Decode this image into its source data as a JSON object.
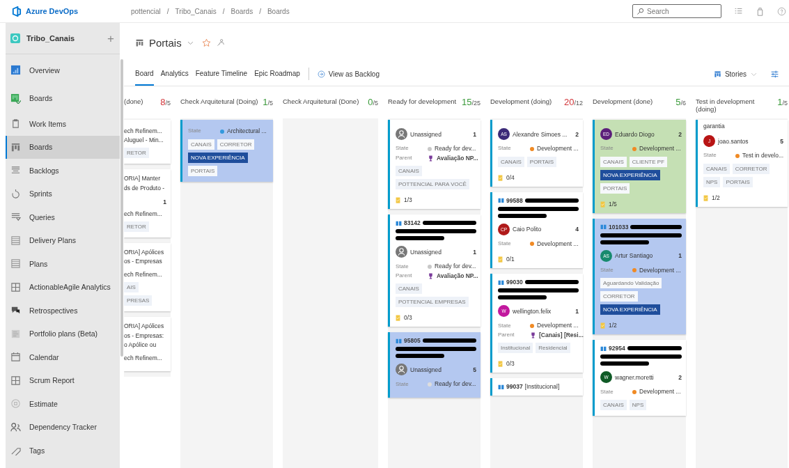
{
  "top_bar": {
    "logo": "Azure DevOps",
    "breadcrumb": [
      {
        "label": "pottencial",
        "separator": "/"
      },
      {
        "label": "Tribo_Canais",
        "separator": "/"
      },
      {
        "label": "Boards",
        "separator": "/"
      },
      {
        "label": "Boards"
      }
    ],
    "search": {
      "placeholder": "Search"
    }
  },
  "sidebar": {
    "project": "Tribo_Canais",
    "add": "+",
    "items": [
      {
        "label": "Overview",
        "selected": false
      },
      {
        "label": "Boards",
        "selected": false,
        "children": [
          {
            "label": "Work Items",
            "selected": false
          },
          {
            "label": "Boards",
            "selected": true
          },
          {
            "label": "Backlogs",
            "selected": false
          },
          {
            "label": "Sprints",
            "selected": false
          },
          {
            "label": "Queries",
            "selected": false
          },
          {
            "label": "Delivery Plans",
            "selected": false
          },
          {
            "label": "Plans",
            "selected": false
          },
          {
            "label": "ActionableAgile Analytics",
            "selected": false
          },
          {
            "label": "Retrospectives",
            "selected": false
          },
          {
            "label": "Portfolio plans (Beta)",
            "selected": false
          },
          {
            "label": "Calendar",
            "selected": false
          },
          {
            "label": "Scrum Report",
            "selected": false
          },
          {
            "label": "Estimate",
            "selected": false
          },
          {
            "label": "Dependency Tracker",
            "selected": false
          },
          {
            "label": "Tags",
            "selected": false
          }
        ]
      }
    ]
  },
  "board_header": {
    "title": "Portais",
    "tabs": [
      {
        "label": "Board",
        "selected": true
      },
      {
        "label": "Analytics",
        "selected": false
      },
      {
        "label": "Feature Timeline",
        "selected": false
      },
      {
        "label": "Epic Roadmap",
        "selected": false
      }
    ],
    "view_backlog": "View as Backlog",
    "level_picker": "Stories"
  },
  "columns": [
    {
      "title": "(done)",
      "count": "8",
      "limit": "/5",
      "over": true,
      "clipped": true,
      "cards": [
        {
          "color": "#ffffff",
          "fields": [
            {
              "kind": "area",
              "value": "ech Refinem..."
            },
            {
              "kind": "area",
              "value": "Aluguel - Min..."
            }
          ],
          "tags": [
            [
              {
                "text": "RETOR",
                "highlight": false
              }
            ]
          ]
        },
        {
          "color": "#ffffff",
          "lines": [
            "ORIA]  Manter",
            "ds de Produto -"
          ],
          "effort": "1",
          "fields": [
            {
              "kind": "area",
              "value": "ech Refinem..."
            }
          ],
          "tags": [
            [
              {
                "text": "RETOR",
                "highlight": false
              }
            ]
          ]
        },
        {
          "color": "#ffffff",
          "lines": [
            "ORIA] Apólices",
            "os - Empresas"
          ],
          "fields": [
            {
              "kind": "area",
              "value": "ech Refinem..."
            }
          ],
          "tags": [
            [
              {
                "text": "AIS",
                "highlight": false
              }
            ],
            [
              {
                "text": "PRESAS",
                "highlight": false
              }
            ]
          ]
        },
        {
          "color": "#ffffff",
          "lines": [
            "ORIA] Apólices",
            "os - Empresas:",
            "o Apólice ou"
          ],
          "fields": [
            {
              "kind": "area",
              "value": "ech Refinem..."
            }
          ]
        }
      ]
    },
    {
      "title": "Check Arquitetural (Doing)",
      "count": "1",
      "limit": "/5",
      "over": false,
      "cards": [
        {
          "color": "#b4c8f0",
          "fields": [
            {
              "kind": "state",
              "label": "State",
              "value": "Architectural ...",
              "color": "#3399dd"
            }
          ],
          "tags": [
            [
              {
                "text": "CANAIS",
                "highlight": false
              },
              {
                "text": "CORRETOR",
                "highlight": false
              }
            ],
            [
              {
                "text": "NOVA EXPERIÊNCIA",
                "highlight": true
              }
            ],
            [
              {
                "text": "PORTAIS",
                "highlight": false
              }
            ]
          ]
        }
      ]
    },
    {
      "title": "Check Arquitetural (Done)",
      "count": "0",
      "limit": "/5",
      "over": false
    },
    {
      "title": "Ready for development",
      "count": "15",
      "limit": "/25",
      "over": false,
      "cards": [
        {
          "color": "#ffffff",
          "assignee": {
            "kind": "unassigned",
            "name": "Unassigned"
          },
          "effort": "1",
          "fields": [
            {
              "kind": "state",
              "label": "State",
              "value": "Ready for dev...",
              "color": "#c8c8c8"
            },
            {
              "kind": "parent",
              "label": "Parent",
              "value": "Avaliação NP..."
            }
          ],
          "tags": [
            [
              {
                "text": "CANAIS",
                "highlight": false
              }
            ],
            [
              {
                "text": "POTTENCIAL PARA VOCÊ",
                "highlight": false
              }
            ]
          ],
          "tasks": "1/3"
        },
        {
          "color": "#ffffff",
          "id": "83142",
          "redacted": true,
          "assignee": {
            "kind": "unassigned",
            "name": "Unassigned"
          },
          "effort": "1",
          "fields": [
            {
              "kind": "state",
              "label": "State",
              "value": "Ready for dev...",
              "color": "#c8c8c8"
            },
            {
              "kind": "parent",
              "label": "Parent",
              "value": "Avaliação NP..."
            }
          ],
          "tags": [
            [
              {
                "text": "CANAIS",
                "highlight": false
              }
            ],
            [
              {
                "text": "POTTENCIAL EMPRESAS",
                "highlight": false
              }
            ]
          ],
          "tasks": "0/3"
        },
        {
          "color": "#b4c8f0",
          "id": "95805",
          "redacted": true,
          "assignee": {
            "kind": "unassigned",
            "name": "Unassigned"
          },
          "effort": "5",
          "fields": [
            {
              "kind": "state",
              "label": "State",
              "value": "Ready for dev...",
              "color": "#dddddd"
            }
          ]
        }
      ]
    },
    {
      "title": "Development (doing)",
      "count": "20",
      "limit": "/12",
      "over": true,
      "cards": [
        {
          "color": "#ffffff",
          "assignee": {
            "kind": "person",
            "initials": "AS",
            "name": "Alexandre Simoes ...",
            "color": "#3b2a78"
          },
          "effort": "2",
          "fields": [
            {
              "kind": "state",
              "label": "State",
              "value": "Development ...",
              "color": "#f08a24"
            }
          ],
          "tags": [
            [
              {
                "text": "CANAIS",
                "highlight": false
              },
              {
                "text": "PORTAIS",
                "highlight": false
              }
            ]
          ],
          "tasks": "0/4"
        },
        {
          "color": "#ffffff",
          "id": "99588",
          "redacted": true,
          "assignee": {
            "kind": "person",
            "initials": "CP",
            "name": "Caio Polito",
            "color": "#b01a1a"
          },
          "effort": "4",
          "fields": [
            {
              "kind": "state",
              "label": "State",
              "value": "Development ...",
              "color": "#f08a24"
            }
          ],
          "tasks": "0/1"
        },
        {
          "color": "#ffffff",
          "id": "99030",
          "redacted": true,
          "assignee": {
            "kind": "person",
            "initials": "W",
            "name": "wellington.felix",
            "color": "#c2189e"
          },
          "effort": "1",
          "fields": [
            {
              "kind": "state",
              "label": "State",
              "value": "Development ...",
              "color": "#f08a24"
            },
            {
              "kind": "parent",
              "label": "Parent",
              "value": "[Canais] [Resi..."
            }
          ],
          "tags": [
            [
              {
                "text": "Institucional",
                "highlight": false
              },
              {
                "text": "Residencial",
                "highlight": false
              }
            ]
          ],
          "tasks": "0/3"
        },
        {
          "color": "#ffffff",
          "id": "99037",
          "text": "[Institucional]"
        }
      ]
    },
    {
      "title": "Development (done)",
      "count": "5",
      "limit": "/6",
      "over": false,
      "cards": [
        {
          "color": "#c5e0b4",
          "assignee": {
            "kind": "person",
            "initials": "ED",
            "name": "Eduardo Diogo",
            "color": "#5c1f7a"
          },
          "effort": "2",
          "fields": [
            {
              "kind": "state",
              "label": "State",
              "value": "Development ...",
              "color": "#f08a24"
            }
          ],
          "tags": [
            [
              {
                "text": "CANAIS",
                "highlight": false
              },
              {
                "text": "CLIENTE PF",
                "highlight": false
              }
            ],
            [
              {
                "text": "NOVA EXPERIÊNCIA",
                "highlight": true
              }
            ],
            [
              {
                "text": "PORTAIS",
                "highlight": false
              }
            ]
          ],
          "tasks": "1/5"
        },
        {
          "color": "#b4c8f0",
          "id": "101033",
          "redacted": true,
          "assignee": {
            "kind": "person",
            "initials": "AS",
            "name": "Artur Santiago",
            "color": "#178a6e"
          },
          "effort": "1",
          "fields": [
            {
              "kind": "state",
              "label": "State",
              "value": "Development ...",
              "color": "#f08a24"
            }
          ],
          "tags": [
            [
              {
                "text": "Aguardando Validação",
                "highlight": false
              }
            ],
            [
              {
                "text": "CORRETOR",
                "highlight": false
              }
            ],
            [
              {
                "text": "NOVA EXPERIÊNCIA",
                "highlight": true
              }
            ]
          ],
          "tasks": "1/2"
        },
        {
          "color": "#ffffff",
          "id": "92954",
          "redacted": true,
          "assignee": {
            "kind": "person",
            "initials": "W",
            "name": "wagner.moretti",
            "color": "#0f5a26"
          },
          "effort": "2",
          "fields": [
            {
              "kind": "state",
              "label": "State",
              "value": "Development ...",
              "color": "#f08a24"
            }
          ],
          "tags": [
            [
              {
                "text": "CANAIS",
                "highlight": false
              },
              {
                "text": "NPS",
                "highlight": false
              }
            ]
          ]
        }
      ]
    },
    {
      "title": "Test in development (doing)",
      "count": "1",
      "limit": "/5",
      "over": false,
      "cards": [
        {
          "color": "#ffffff",
          "text": "garantia",
          "assignee": {
            "kind": "person",
            "initials": "J",
            "name": "joao.santos",
            "color": "#b81414"
          },
          "effort": "5",
          "fields": [
            {
              "kind": "state",
              "label": "State",
              "value": "Test in develo...",
              "color": "#f08a24"
            }
          ],
          "tags": [
            [
              {
                "text": "CANAIS",
                "highlight": false
              },
              {
                "text": "CORRETOR",
                "highlight": false
              }
            ],
            [
              {
                "text": "NPS",
                "highlight": false
              },
              {
                "text": "PORTAIS",
                "highlight": false
              }
            ]
          ],
          "tasks": "1/2"
        }
      ]
    }
  ]
}
